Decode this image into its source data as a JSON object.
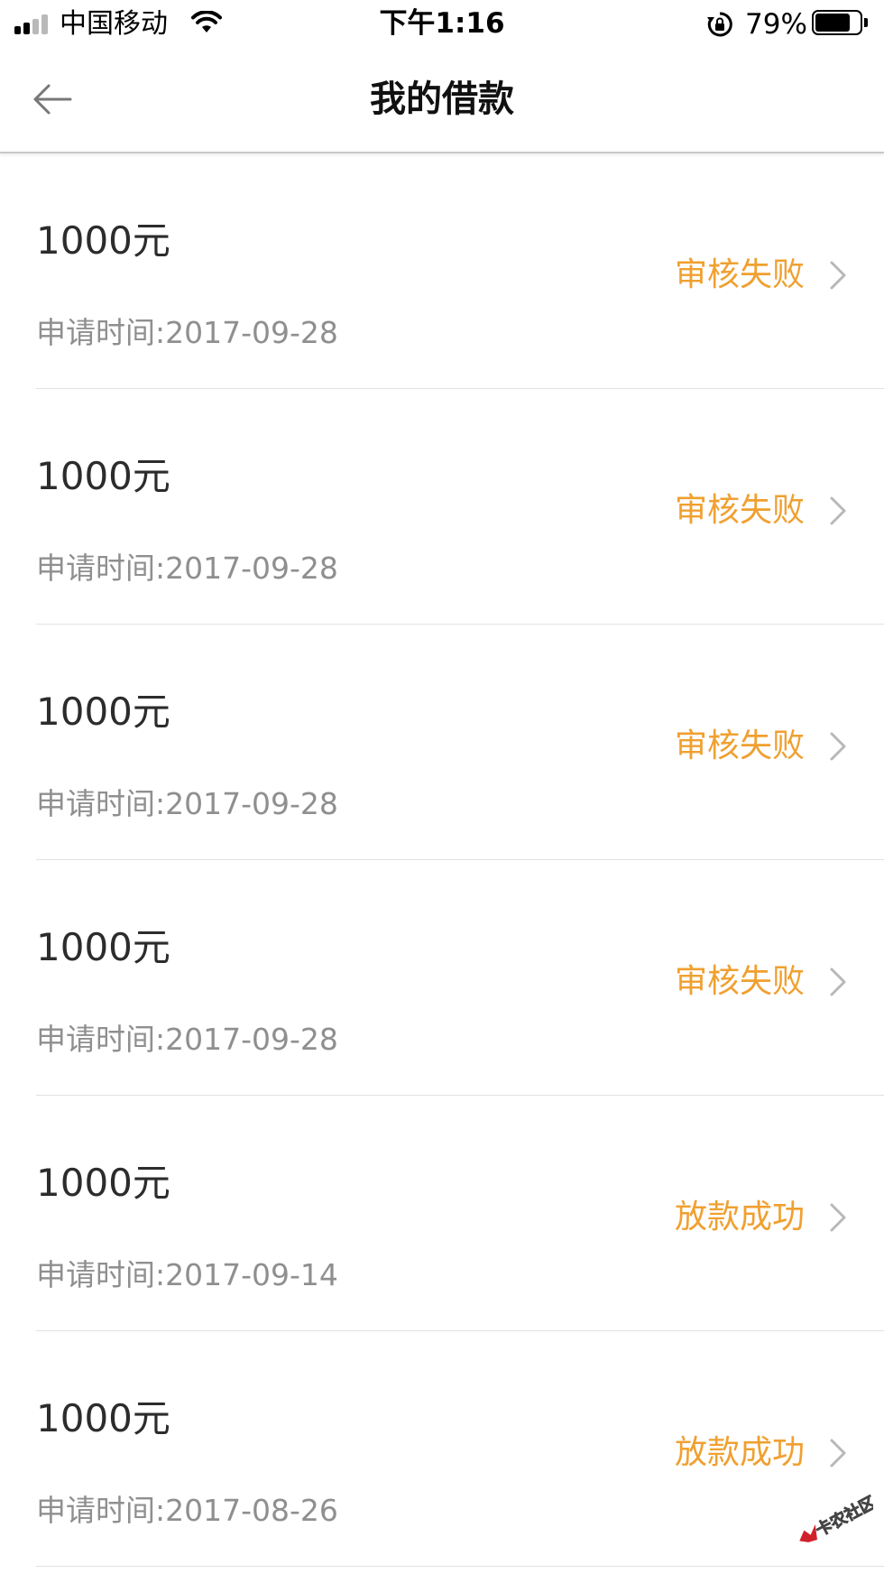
{
  "status_bar": {
    "carrier": "中国移动",
    "time": "下午1:16",
    "battery": "79%",
    "icons": [
      "signal-icon",
      "wifi-icon",
      "rotation-lock-icon",
      "battery-icon"
    ]
  },
  "nav": {
    "title": "我的借款",
    "back_icon": "arrow-left-icon"
  },
  "loans": [
    {
      "amount": "1000元",
      "date_label": "申请时间:",
      "date": "2017-09-28",
      "status": "审核失败"
    },
    {
      "amount": "1000元",
      "date_label": "申请时间:",
      "date": "2017-09-28",
      "status": "审核失败"
    },
    {
      "amount": "1000元",
      "date_label": "申请时间:",
      "date": "2017-09-28",
      "status": "审核失败"
    },
    {
      "amount": "1000元",
      "date_label": "申请时间:",
      "date": "2017-09-28",
      "status": "审核失败"
    },
    {
      "amount": "1000元",
      "date_label": "申请时间:",
      "date": "2017-09-14",
      "status": "放款成功"
    },
    {
      "amount": "1000元",
      "date_label": "申请时间:",
      "date": "2017-08-26",
      "status": "放款成功"
    }
  ],
  "watermark": "卡农社区",
  "colors": {
    "status_accent": "#f0a030",
    "amount_text": "#2c2c2c",
    "secondary_text": "#8f8f8f",
    "divider": "#e2e2e2",
    "watermark_red": "#d0202a"
  }
}
